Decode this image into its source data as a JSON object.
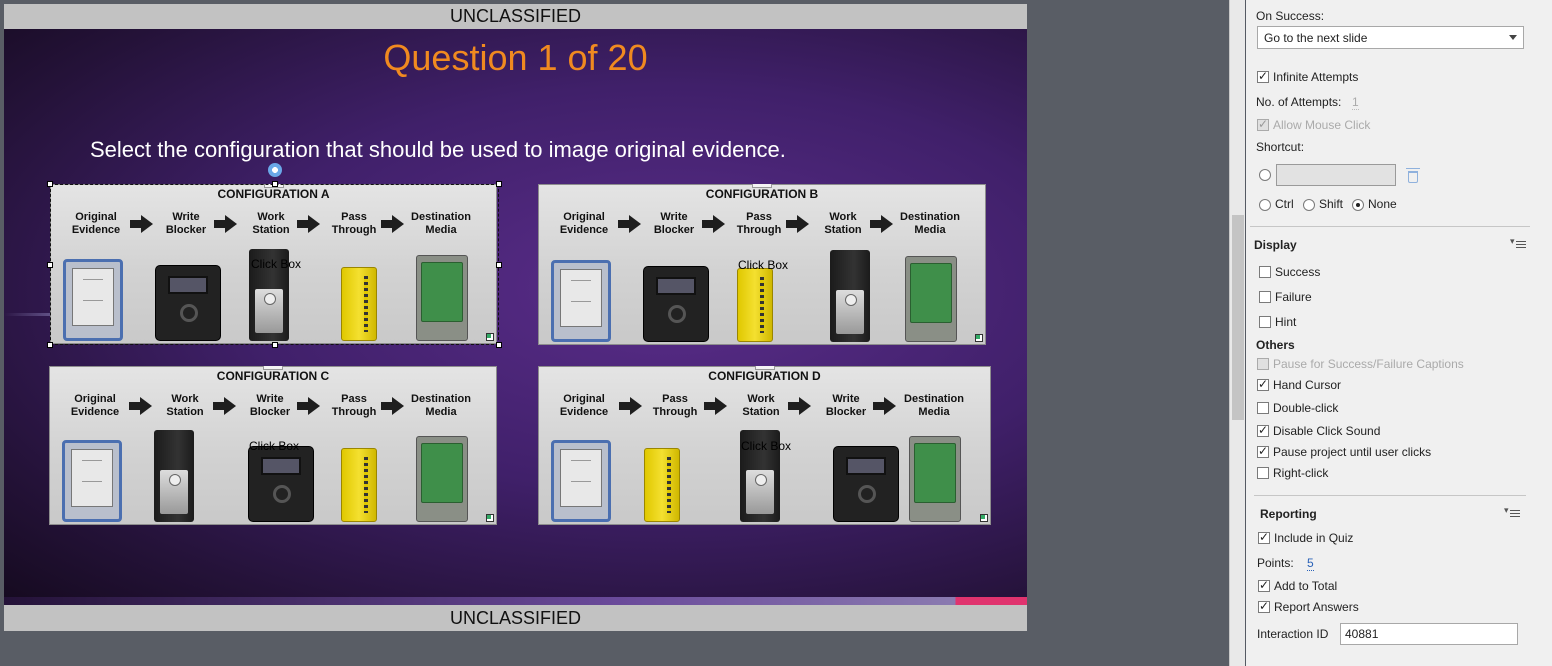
{
  "slide": {
    "banner_top": "UNCLASSIFIED",
    "banner_bottom": "UNCLASSIFIED",
    "title": "Question 1 of 20",
    "question": "Select the configuration that should be used to image original evidence.",
    "click_box_label": "Click Box",
    "configurations": [
      {
        "title": "CONFIGURATION A",
        "steps": [
          {
            "label": "Original\nEvidence",
            "device": "original-evidence-hdd"
          },
          {
            "label": "Write\nBlocker",
            "device": "write-blocker"
          },
          {
            "label": "Work\nStation",
            "device": "workstation-tower"
          },
          {
            "label": "Pass\nThrough",
            "device": "pass-through"
          },
          {
            "label": "Destination\nMedia",
            "device": "destination-hdd"
          }
        ]
      },
      {
        "title": "CONFIGURATION B",
        "steps": [
          {
            "label": "Original\nEvidence",
            "device": "original-evidence-hdd"
          },
          {
            "label": "Write\nBlocker",
            "device": "write-blocker"
          },
          {
            "label": "Pass\nThrough",
            "device": "pass-through"
          },
          {
            "label": "Work\nStation",
            "device": "workstation-tower"
          },
          {
            "label": "Destination\nMedia",
            "device": "destination-hdd"
          }
        ]
      },
      {
        "title": "CONFIGURATION C",
        "steps": [
          {
            "label": "Original\nEvidence",
            "device": "original-evidence-hdd"
          },
          {
            "label": "Work\nStation",
            "device": "workstation-tower"
          },
          {
            "label": "Write\nBlocker",
            "device": "write-blocker"
          },
          {
            "label": "Pass\nThrough",
            "device": "pass-through"
          },
          {
            "label": "Destination\nMedia",
            "device": "destination-hdd"
          }
        ]
      },
      {
        "title": "CONFIGURATION D",
        "steps": [
          {
            "label": "Original\nEvidence",
            "device": "original-evidence-hdd"
          },
          {
            "label": "Pass\nThrough",
            "device": "pass-through"
          },
          {
            "label": "Work\nStation",
            "device": "workstation-tower"
          },
          {
            "label": "Write\nBlocker",
            "device": "write-blocker"
          },
          {
            "label": "Destination\nMedia",
            "device": "destination-hdd"
          }
        ]
      }
    ],
    "selected_configuration": "CONFIGURATION A"
  },
  "panel": {
    "on_success_label": "On Success:",
    "on_success_value": "Go to the next slide",
    "infinite_attempts_label": "Infinite Attempts",
    "infinite_attempts_checked": true,
    "attempts_label": "No. of Attempts:",
    "attempts_value": "1",
    "allow_mouse_click_label": "Allow Mouse Click",
    "shortcut_label": "Shortcut:",
    "shortcut_value": "",
    "modifier_ctrl": "Ctrl",
    "modifier_shift": "Shift",
    "modifier_none": "None",
    "modifier_selected": "None",
    "display_header": "Display",
    "display_success": "Success",
    "display_failure": "Failure",
    "display_hint": "Hint",
    "others_header": "Others",
    "pause_captions_label": "Pause for Success/Failure Captions",
    "hand_cursor_label": "Hand Cursor",
    "double_click_label": "Double-click",
    "disable_click_sound_label": "Disable Click Sound",
    "pause_project_label": "Pause project until user clicks",
    "right_click_label": "Right-click",
    "reporting_header": "Reporting",
    "include_in_quiz_label": "Include in Quiz",
    "points_label": "Points:",
    "points_value": "5",
    "add_to_total_label": "Add to Total",
    "report_answers_label": "Report Answers",
    "interaction_id_label": "Interaction ID",
    "interaction_id_value": "40881"
  },
  "colors": {
    "title_orange": "#f08a20",
    "slide_purple": "#40206a",
    "link_blue": "#2a62b8",
    "accent_pink": "#e0336e"
  },
  "icons": [
    "rotate-handle-icon",
    "resize-corner-icon",
    "trash-icon",
    "panel-menu-icon",
    "dropdown-arrow-icon",
    "checkmark-icon"
  ]
}
